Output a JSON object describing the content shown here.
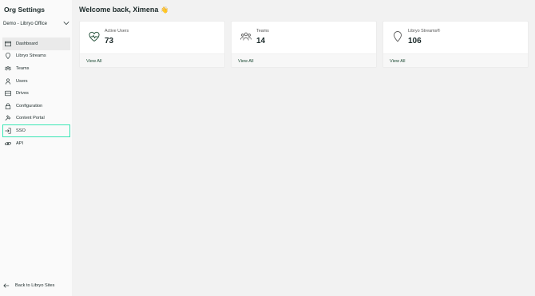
{
  "sidebar": {
    "title": "Org Settings",
    "org_select": {
      "value": "Demo - Libryo Office",
      "icon": "chevron-down-icon"
    },
    "items": [
      {
        "label": "Dashboard",
        "icon": "browser-window-icon",
        "active": true
      },
      {
        "label": "Libryo Streams",
        "icon": "location-pin-icon"
      },
      {
        "label": "Teams",
        "icon": "team-icon"
      },
      {
        "label": "Users",
        "icon": "user-icon"
      },
      {
        "label": "Drives",
        "icon": "drive-icon"
      },
      {
        "label": "Configuration",
        "icon": "lock-icon"
      },
      {
        "label": "Content Portal",
        "icon": "hammer-icon"
      },
      {
        "label": "SSO",
        "icon": "sign-in-icon",
        "focused": true
      },
      {
        "label": "API",
        "icon": "link-icon"
      }
    ],
    "back_link": {
      "label": "Back to Libryo Sites",
      "icon": "arrow-left-icon"
    }
  },
  "main": {
    "welcome": "Welcome back, Ximena",
    "welcome_emoji": "👋",
    "cards": [
      {
        "label": "Active Users",
        "value": "73",
        "icon": "heart-pulse-icon",
        "link": "View All"
      },
      {
        "label": "Teams",
        "value": "14",
        "icon": "team-icon",
        "link": "View All"
      },
      {
        "label": "Libryo Streams®",
        "value": "106",
        "icon": "location-pin-icon",
        "link": "View All"
      }
    ]
  },
  "colors": {
    "sidebar_bg": "#fafafa",
    "page_bg": "#f2f2f2",
    "active_item_bg": "#eaeaea",
    "focus_outline": "#3ae6b5",
    "link_color": "#1c4a33"
  }
}
